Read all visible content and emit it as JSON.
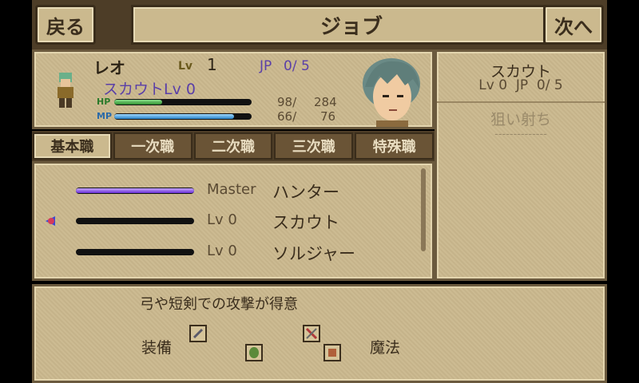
{
  "header": {
    "back_label": "戻る",
    "title": "ジョブ",
    "next_label": "次へ"
  },
  "character": {
    "name": "レオ",
    "lv_label": "Lv",
    "level": "1",
    "jp_label": "JP",
    "jp_value": "0/ 5",
    "job": "スカウトLv 0",
    "hp_label": "HP",
    "hp_current": "98/",
    "hp_max": "284",
    "hp_ratio": 0.35,
    "mp_label": "MP",
    "mp_current": "66/",
    "mp_max": "76",
    "mp_ratio": 0.87
  },
  "selected_job": {
    "name": "スカウト",
    "stats": "Lv 0  JP  0/ 5",
    "skill": "狙い射ち",
    "separator": "--------------"
  },
  "tabs": [
    {
      "label": "基本職",
      "active": true
    },
    {
      "label": "一次職",
      "active": false
    },
    {
      "label": "二次職",
      "active": false
    },
    {
      "label": "三次職",
      "active": false
    },
    {
      "label": "特殊職",
      "active": false
    }
  ],
  "jobs": [
    {
      "level": "Master",
      "name": "ハンター",
      "progress": 1.0
    },
    {
      "level": "Lv  0",
      "name": "スカウト",
      "progress": 0.0,
      "selected": true
    },
    {
      "level": "Lv  0",
      "name": "ソルジャー",
      "progress": 0.0
    }
  ],
  "description": {
    "text": "弓や短剣での攻撃が得意",
    "equip_label": "装備",
    "magic_label": "魔法"
  },
  "colors": {
    "parchment": "#cbb98e",
    "frame": "#4d3d27",
    "hp": "#3aa63a",
    "mp": "#3a9ad6",
    "job_bar": "#7a3fe0",
    "name_purple": "#5a3fa8"
  },
  "icons": [
    "sword-icon",
    "shield-icon",
    "dagger-icon",
    "armor-icon",
    "selection-cursor-icon"
  ]
}
